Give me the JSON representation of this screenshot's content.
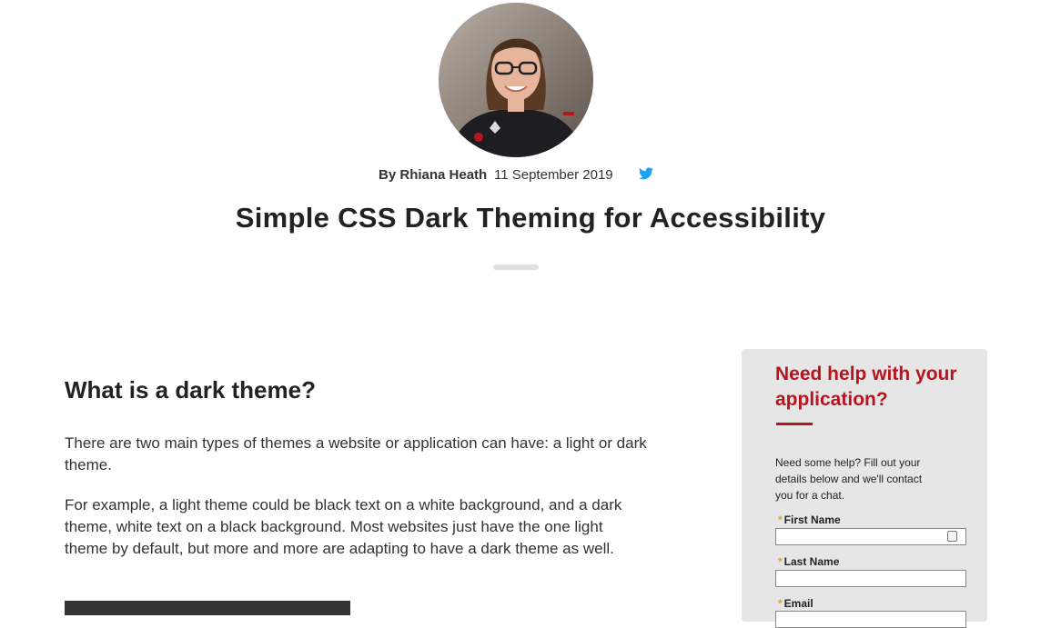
{
  "author": {
    "by_label": "By",
    "name": "Rhiana Heath",
    "date": "11 September 2019"
  },
  "icons": {
    "avatar": "author-photo",
    "social": "twitter-icon",
    "autofill": "contact-card-icon"
  },
  "article": {
    "title": "Simple CSS Dark Theming for Accessibility",
    "section_heading": "What is a dark theme?",
    "paragraph_1": "There are two main types of themes a website or application can have: a light or dark theme.",
    "paragraph_2": "For example, a light theme could be black text on a white background, and a dark theme, white text on a black background. Most websites just have the one light theme by default, but more and more are adapting to have a dark theme as well."
  },
  "sidebar": {
    "heading": "Need help with your application?",
    "help_text": "Need some help? Fill out your details below and we'll contact you for a chat.",
    "required_marker": "*",
    "fields": [
      {
        "label": "First Name",
        "value": ""
      },
      {
        "label": "Last Name",
        "value": ""
      },
      {
        "label": "Email",
        "value": ""
      }
    ]
  },
  "colors": {
    "accent_red": "#b8141e",
    "twitter_blue": "#1da1f2",
    "required_star": "#e1a51f",
    "sidebar_bg": "#e6e6e6"
  }
}
